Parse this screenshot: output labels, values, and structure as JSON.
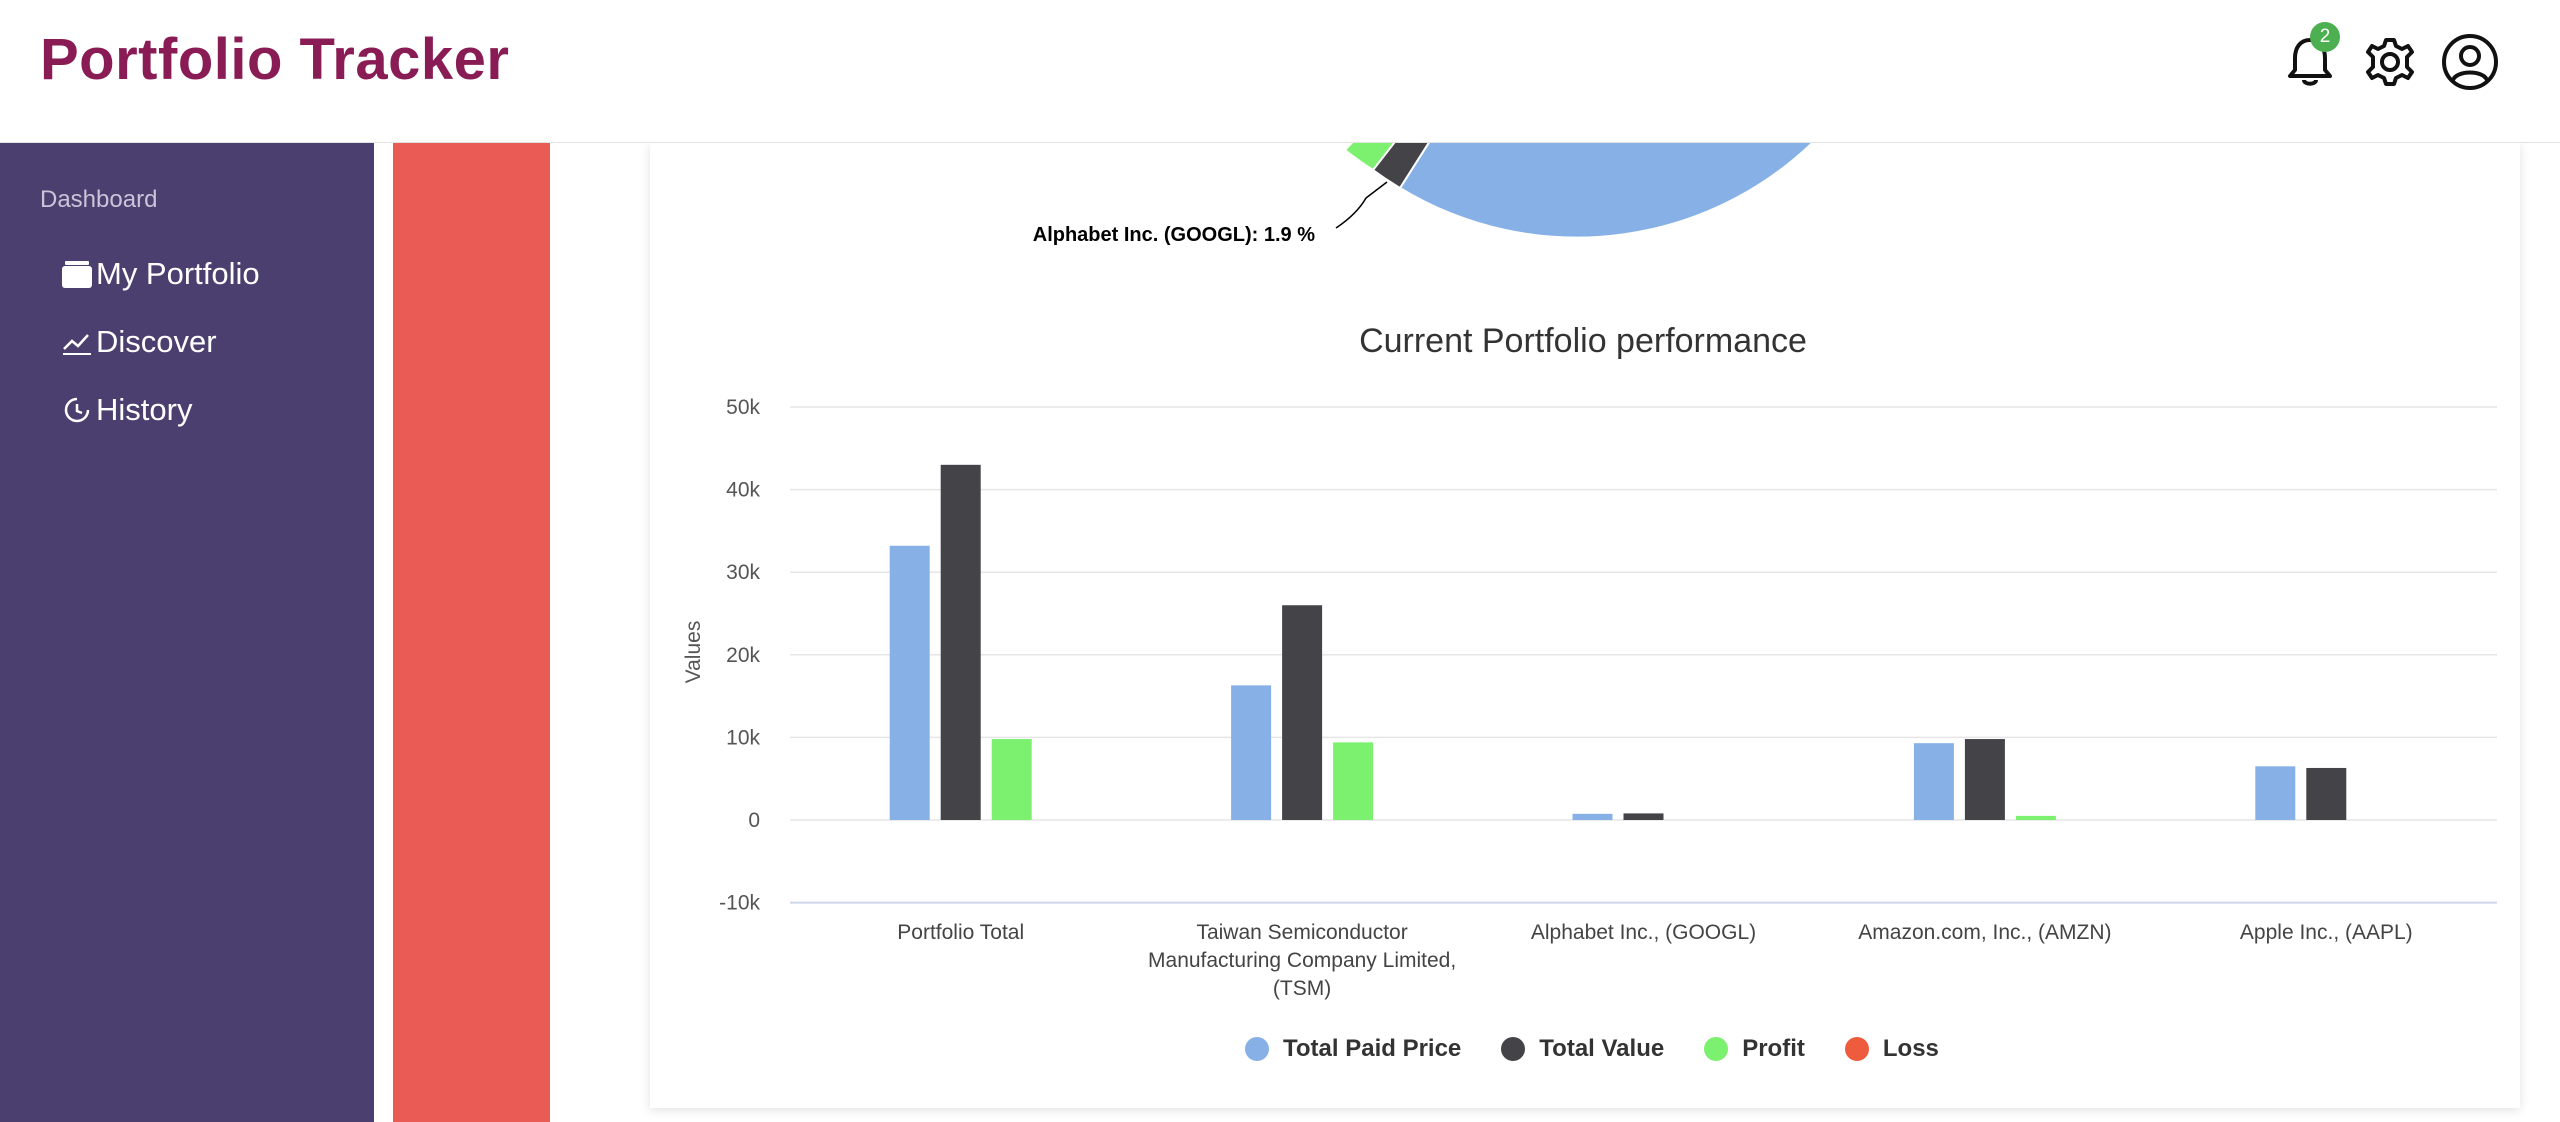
{
  "header": {
    "title": "Portfolio Tracker",
    "notification_count": "2",
    "icons": [
      "bell-icon",
      "gear-icon",
      "user-circle-icon"
    ]
  },
  "sidebar": {
    "section": "Dashboard",
    "items": [
      {
        "label": "My Portfolio",
        "icon": "wallet-icon"
      },
      {
        "label": "Discover",
        "icon": "trend-icon"
      },
      {
        "label": "History",
        "icon": "history-icon"
      }
    ]
  },
  "pie": {
    "label": "Alphabet Inc. (GOOGL): 1.9 %"
  },
  "colors": {
    "total_paid": "#87b1e6",
    "total_value": "#434348",
    "profit": "#7cf06f",
    "loss": "#ef5b3d",
    "brand": "#8a1c55",
    "sidebar": "#4a3f6e",
    "redbar": "#eb5b56"
  },
  "chart_data": {
    "type": "bar",
    "title": "Current Portfolio performance",
    "ylabel": "Values",
    "xlabel": "",
    "ylim": [
      -10000,
      50000
    ],
    "yticks": [
      "-10k",
      "0",
      "10k",
      "20k",
      "30k",
      "40k",
      "50k"
    ],
    "categories": [
      [
        "Portfolio Total"
      ],
      [
        "Taiwan Semiconductor",
        "Manufacturing Company Limited,",
        "(TSM)"
      ],
      [
        "Alphabet Inc., (GOOGL)"
      ],
      [
        "Amazon.com, Inc., (AMZN)"
      ],
      [
        "Apple Inc., (AAPL)"
      ]
    ],
    "series": [
      {
        "name": "Total Paid Price",
        "values": [
          33200,
          16300,
          750,
          9300,
          6500
        ]
      },
      {
        "name": "Total Value",
        "values": [
          43000,
          26000,
          800,
          9800,
          6300
        ]
      },
      {
        "name": "Profit",
        "values": [
          9800,
          9400,
          0,
          500,
          0
        ]
      },
      {
        "name": "Loss",
        "values": [
          0,
          0,
          0,
          0,
          0
        ]
      }
    ],
    "grid": true,
    "legend": "bottom-center"
  }
}
